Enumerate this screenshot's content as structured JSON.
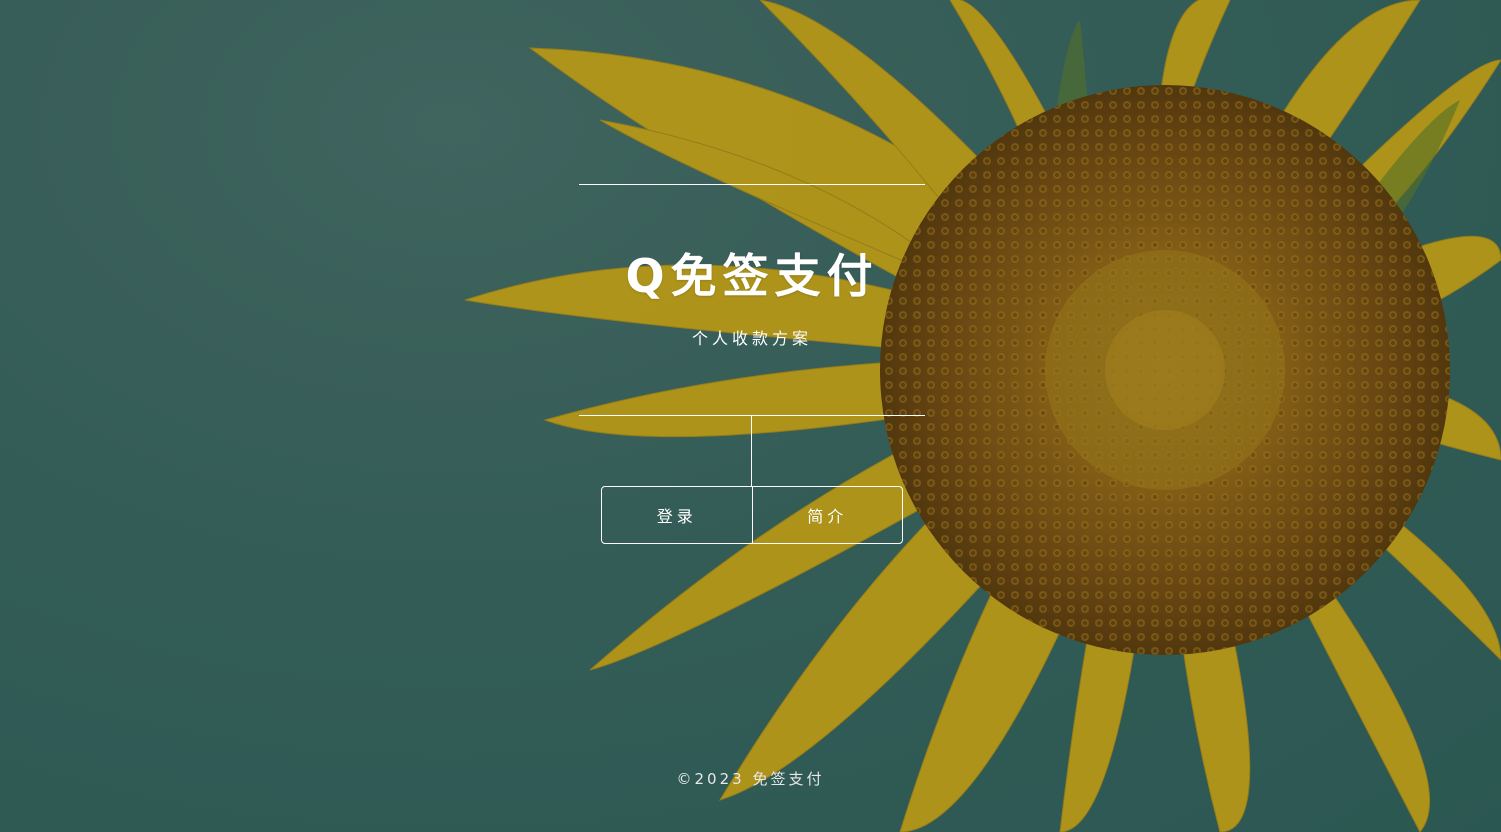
{
  "header": {
    "title": "Q免签支付",
    "subtitle": "个人收款方案"
  },
  "nav": {
    "login_label": "登录",
    "intro_label": "简介"
  },
  "footer": {
    "copyright": "©2023 免签支付"
  },
  "colors": {
    "background_teal": "#3a655f",
    "petal_yellow": "#c9a81a",
    "flower_center": "#7a5418",
    "text": "#ffffff"
  }
}
